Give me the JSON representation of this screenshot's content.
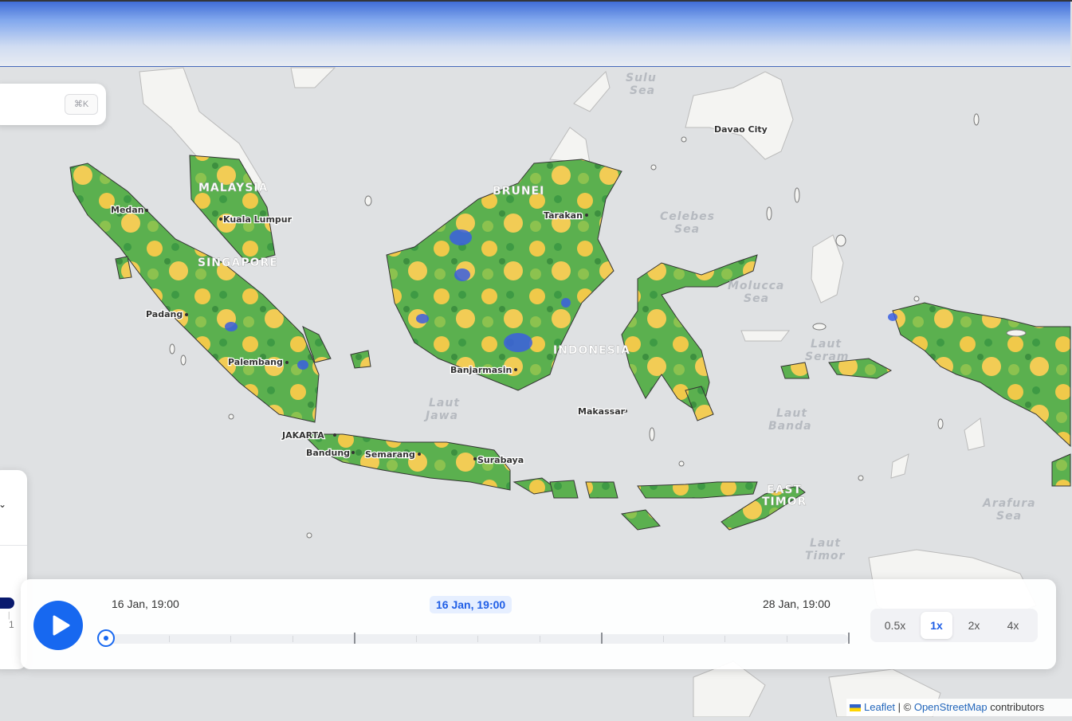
{
  "map": {
    "countries": [
      "MALAYSIA",
      "SINGAPORE",
      "BRUNEI",
      "INDONESIA",
      "EAST",
      "TIMOR"
    ],
    "seas": [
      {
        "line1": "Sulu",
        "line2": "Sea"
      },
      {
        "line1": "Celebes",
        "line2": "Sea"
      },
      {
        "line1": "Molucca",
        "line2": "Sea"
      },
      {
        "line1": "Laut",
        "line2": "Jawa"
      },
      {
        "line1": "Laut",
        "line2": "Banda"
      },
      {
        "line1": "Laut",
        "line2": "Seram"
      },
      {
        "line1": "Arafura",
        "line2": "Sea"
      },
      {
        "line1": "Laut",
        "line2": "Timor"
      }
    ],
    "cities": [
      "Medan",
      "Kuala Lumpur",
      "Padang",
      "Palembang",
      "JAKARTA",
      "Bandung",
      "Semarang",
      "Surabaya",
      "Banjarmasin",
      "Tarakan",
      "Makassar",
      "Davao City"
    ],
    "overlay_colors": {
      "land": "#f4f4f2",
      "green": "#4aa84a",
      "yellow": "#f2c94c",
      "blue": "#3b5fe0",
      "water": "#dfe1e3"
    }
  },
  "search": {
    "shortcut": "⌘K"
  },
  "side_panel": {
    "value": "1"
  },
  "player": {
    "play_icon": "play-icon",
    "start_label": "16 Jan, 19:00",
    "current_label": "16 Jan, 19:00",
    "end_label": "28 Jan, 19:00",
    "progress": 0,
    "speeds": [
      "0.5x",
      "1x",
      "2x",
      "4x"
    ],
    "active_speed": "1x"
  },
  "attribution": {
    "leaflet": "Leaflet",
    "sep": " | © ",
    "osm": "OpenStreetMap",
    "suffix": " contributors"
  }
}
